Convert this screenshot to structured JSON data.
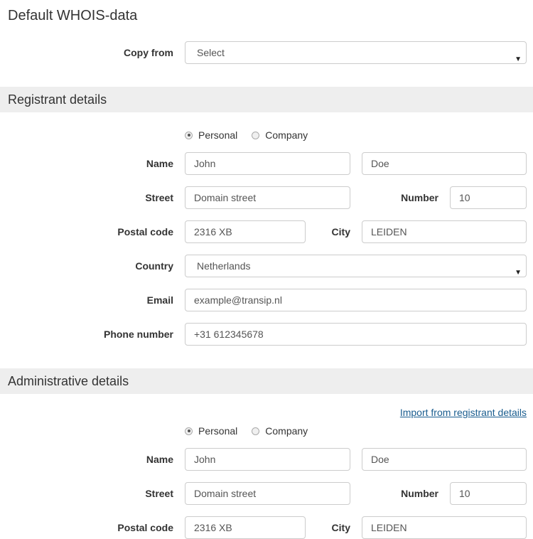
{
  "page_title": "Default WHOIS-data",
  "copy_from": {
    "label": "Copy from",
    "selected": "Select"
  },
  "registrant": {
    "section_title": "Registrant details",
    "type_options": [
      {
        "label": "Personal",
        "checked": true
      },
      {
        "label": "Company",
        "checked": false
      }
    ],
    "labels": {
      "name": "Name",
      "street": "Street",
      "number": "Number",
      "postal_code": "Postal code",
      "city": "City",
      "country": "Country",
      "email": "Email",
      "phone": "Phone number"
    },
    "values": {
      "first_name": "John",
      "last_name": "Doe",
      "street": "Domain street",
      "number": "10",
      "postal_code": "2316 XB",
      "city": "LEIDEN",
      "country": "Netherlands",
      "email": "example@transip.nl",
      "phone": "+31 612345678"
    }
  },
  "administrative": {
    "section_title": "Administrative details",
    "import_link": "Import from registrant details",
    "type_options": [
      {
        "label": "Personal",
        "checked": true
      },
      {
        "label": "Company",
        "checked": false
      }
    ],
    "labels": {
      "name": "Name",
      "street": "Street",
      "number": "Number",
      "postal_code": "Postal code",
      "city": "City"
    },
    "values": {
      "first_name": "John",
      "last_name": "Doe",
      "street": "Domain street",
      "number": "10",
      "postal_code": "2316 XB",
      "city": "LEIDEN"
    }
  },
  "icons": {
    "dropdown_arrow": "▼"
  }
}
